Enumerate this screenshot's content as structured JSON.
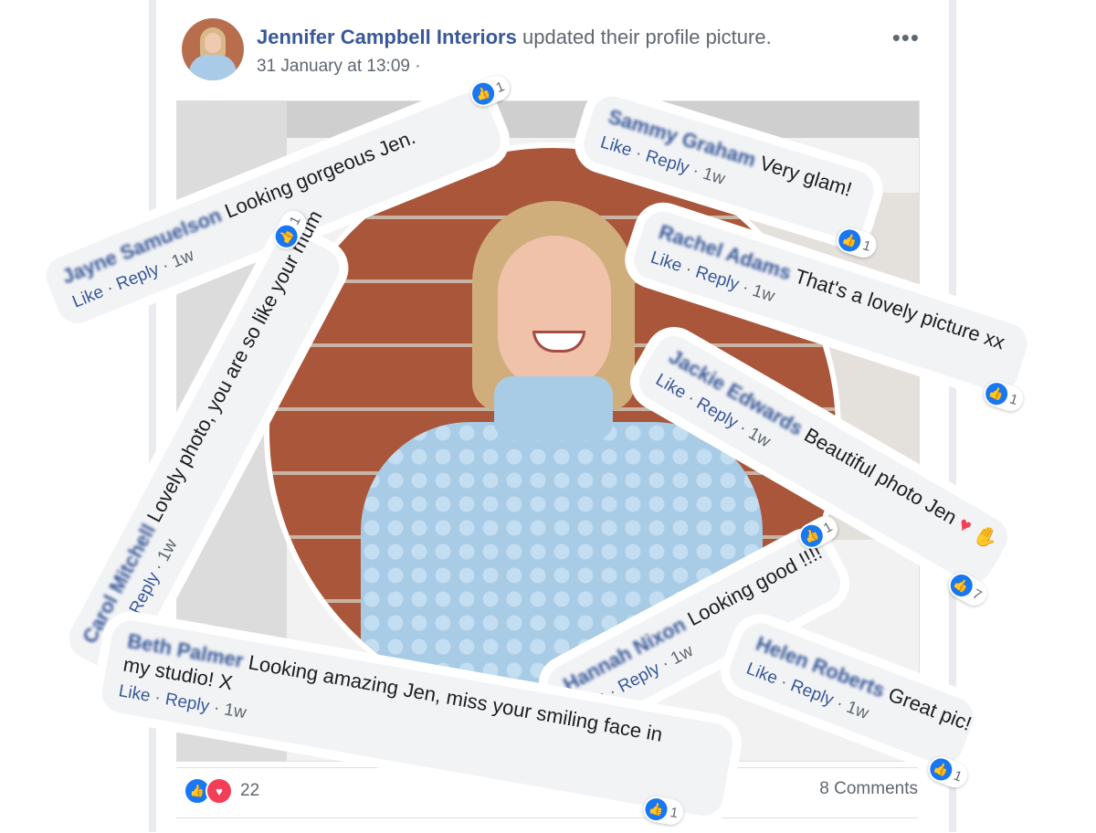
{
  "post": {
    "page_name": "Jennifer Campbell Interiors",
    "action_text": "updated their profile picture.",
    "timestamp": "31 January at 13:09 ·",
    "more_icon": "more-icon"
  },
  "comments": [
    {
      "name": "Jayne Samuelson",
      "text": "Looking gorgeous Jen.",
      "like": "Like",
      "reply": "Reply",
      "time": "1w",
      "reactions": "1"
    },
    {
      "name": "Sammy Graham",
      "text": "Very glam!",
      "like": "Like",
      "reply": "Reply",
      "time": "1w",
      "reactions": "1"
    },
    {
      "name": "Rachel Adams",
      "text": "That's a lovely picture xx",
      "like": "Like",
      "reply": "Reply",
      "time": "1w",
      "reactions": "1"
    },
    {
      "name": "Carol Mitchell",
      "text": "Lovely photo, you are so like your mum",
      "like": "Like",
      "reply": "Reply",
      "time": "1w",
      "reactions": "1"
    },
    {
      "name": "Jackie Edwards",
      "text": "Beautiful photo Jen",
      "like": "Like",
      "reply": "Reply",
      "time": "1w",
      "reactions": "7"
    },
    {
      "name": "Hannah Nixon",
      "text": "Looking good !!!!",
      "like": "Like",
      "reply": "Reply",
      "time": "1w",
      "reactions": "1"
    },
    {
      "name": "Beth Palmer",
      "text": "Looking amazing Jen, miss your smiling face in my studio! X",
      "like": "Like",
      "reply": "Reply",
      "time": "1w",
      "reactions": "1"
    },
    {
      "name": "Helen Roberts",
      "text": "Great pic!",
      "like": "Like",
      "reply": "Reply",
      "time": "1w",
      "reactions": "1"
    }
  ],
  "footer": {
    "reaction_count": "22",
    "comments_count": "8 Comments"
  },
  "colors": {
    "link": "#385898",
    "like_blue": "#1877f2",
    "love_red": "#f33e58",
    "bubble": "#f2f3f5"
  }
}
